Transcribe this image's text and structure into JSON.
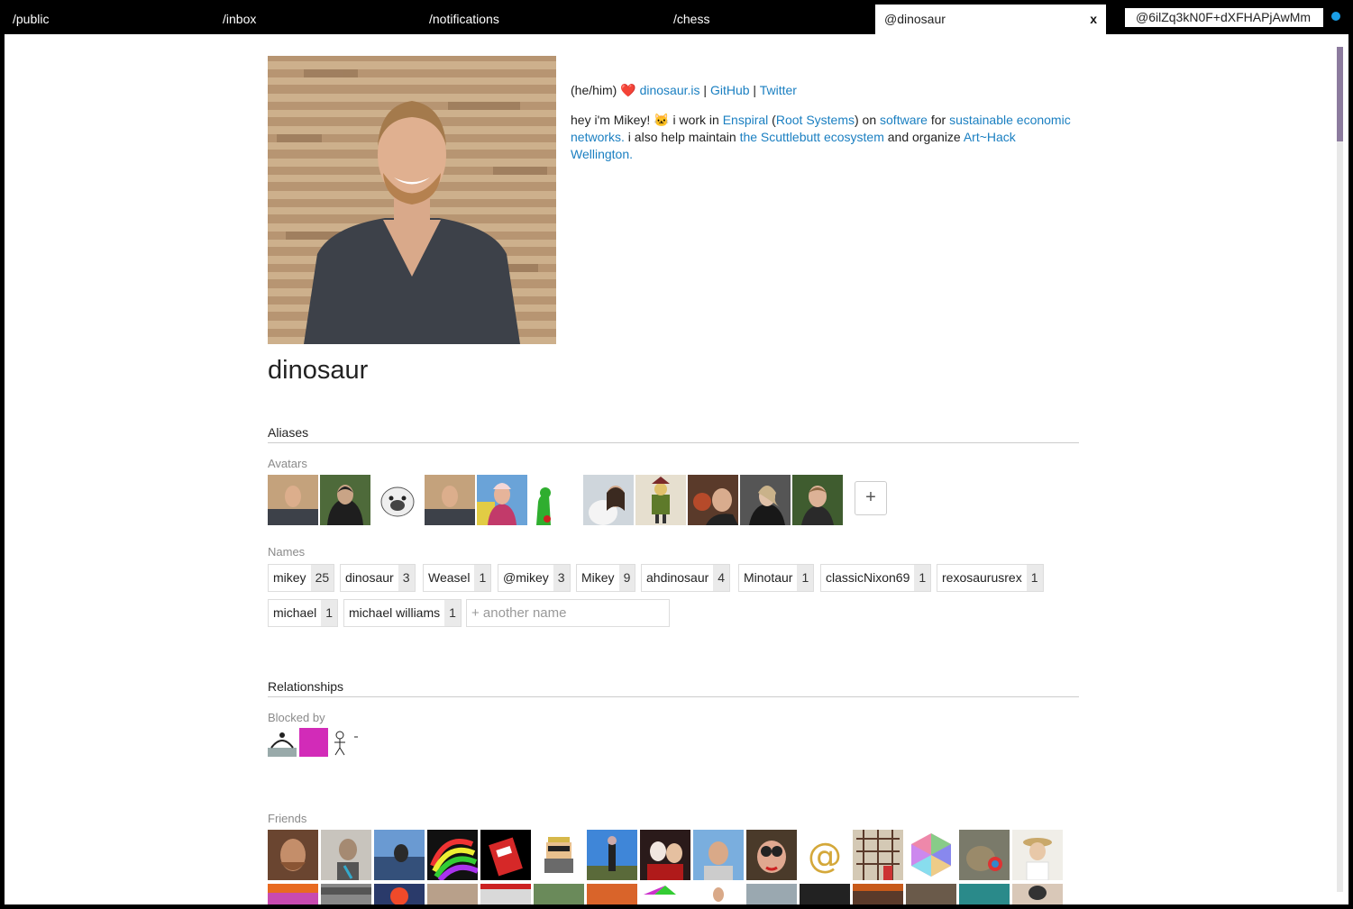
{
  "nav": {
    "tabs": [
      {
        "label": "/public"
      },
      {
        "label": "/inbox"
      },
      {
        "label": "/notifications"
      },
      {
        "label": "/chess"
      }
    ],
    "active_tab": {
      "label": "@dinosaur",
      "close": "x"
    },
    "search_value": "@6ilZq3kN0F+dXFHAPjAwMm"
  },
  "profile": {
    "name": "dinosaur",
    "bio_line1": {
      "pronouns": "(he/him)",
      "heart": "❤️",
      "link1": "dinosaur.is",
      "sep1": " | ",
      "link2": "GitHub",
      "sep2": " | ",
      "link3": "Twitter"
    },
    "bio_line2": {
      "t1": "hey i'm Mikey! ",
      "cat": "🐱",
      "t2": " i work in ",
      "l1": "Enspiral",
      "t3": " (",
      "l2": "Root Systems",
      "t4": ") on ",
      "l3": "software",
      "t5": " for ",
      "l4": "sustainable economic networks.",
      "t6": " i also help maintain ",
      "l5": "the Scuttlebutt ecosystem",
      "t7": " and organize ",
      "l6": "Art~Hack Wellington."
    }
  },
  "aliases": {
    "title": "Aliases",
    "avatars_label": "Avatars",
    "add_label": "+",
    "names_label": "Names",
    "names": [
      {
        "name": "mikey",
        "count": "25"
      },
      {
        "name": "dinosaur",
        "count": "3"
      },
      {
        "name": "Weasel",
        "count": "1"
      },
      {
        "name": "@mikey",
        "count": "3"
      },
      {
        "name": "Mikey",
        "count": "9"
      },
      {
        "name": "ahdinosaur",
        "count": "4"
      },
      {
        "name": "Minotaur",
        "count": "1"
      },
      {
        "name": "classicNixon69",
        "count": "1"
      },
      {
        "name": "rexosaurusrex",
        "count": "1"
      },
      {
        "name": "michael",
        "count": "1"
      },
      {
        "name": "michael williams",
        "count": "1"
      }
    ],
    "name_placeholder": "+ another name"
  },
  "relationships": {
    "title": "Relationships",
    "blocked_label": "Blocked by",
    "friends_label": "Friends"
  },
  "colors": {
    "link": "#1a7fc1",
    "status_dot": "#1a9ee6",
    "scroll_thumb": "#8c7b9e"
  }
}
